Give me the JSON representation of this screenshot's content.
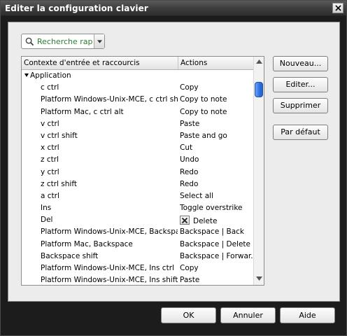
{
  "window": {
    "title": "Editer la configuration clavier"
  },
  "search": {
    "value": "Recherche rap"
  },
  "table": {
    "columns": [
      "Contexte d'entrée et raccourcis",
      "Actions"
    ],
    "rows": [
      {
        "context": "Application",
        "action": "",
        "group": true
      },
      {
        "context": "c ctrl",
        "action": "Copy"
      },
      {
        "context": "Platform Windows-Unix-MCE, c ctrl shift",
        "action": "Copy to note"
      },
      {
        "context": "Platform Mac, c ctrl alt",
        "action": "Copy to note"
      },
      {
        "context": "v ctrl",
        "action": "Paste"
      },
      {
        "context": "v ctrl shift",
        "action": "Paste and go"
      },
      {
        "context": "x ctrl",
        "action": "Cut"
      },
      {
        "context": "z ctrl",
        "action": "Undo"
      },
      {
        "context": "y ctrl",
        "action": "Redo"
      },
      {
        "context": "z ctrl shift",
        "action": "Redo"
      },
      {
        "context": "a ctrl",
        "action": "Select all"
      },
      {
        "context": "Ins",
        "action": "Toggle overstrike"
      },
      {
        "context": "Del",
        "action": "Delete",
        "delete_icon": true
      },
      {
        "context": "Platform Windows-Unix-MCE, Backspace",
        "action": "Backspace | Back"
      },
      {
        "context": "Platform Mac, Backspace",
        "action": "Backspace | Delete ..."
      },
      {
        "context": "Backspace shift",
        "action": "Backspace | Forwar..."
      },
      {
        "context": "Platform Windows-Unix-MCE, Ins ctrl",
        "action": "Copy"
      },
      {
        "context": "Platform Windows-Unix-MCE, Ins shift",
        "action": "Paste"
      }
    ]
  },
  "side_buttons": {
    "new": "Nouveau...",
    "edit": "Editer...",
    "delete": "Supprimer",
    "default": "Par défaut"
  },
  "footer": {
    "ok": "OK",
    "cancel": "Annuler",
    "help": "Aide"
  },
  "icons": {
    "close": "close-icon",
    "search": "search-icon",
    "dropdown": "chevron-down-icon"
  }
}
